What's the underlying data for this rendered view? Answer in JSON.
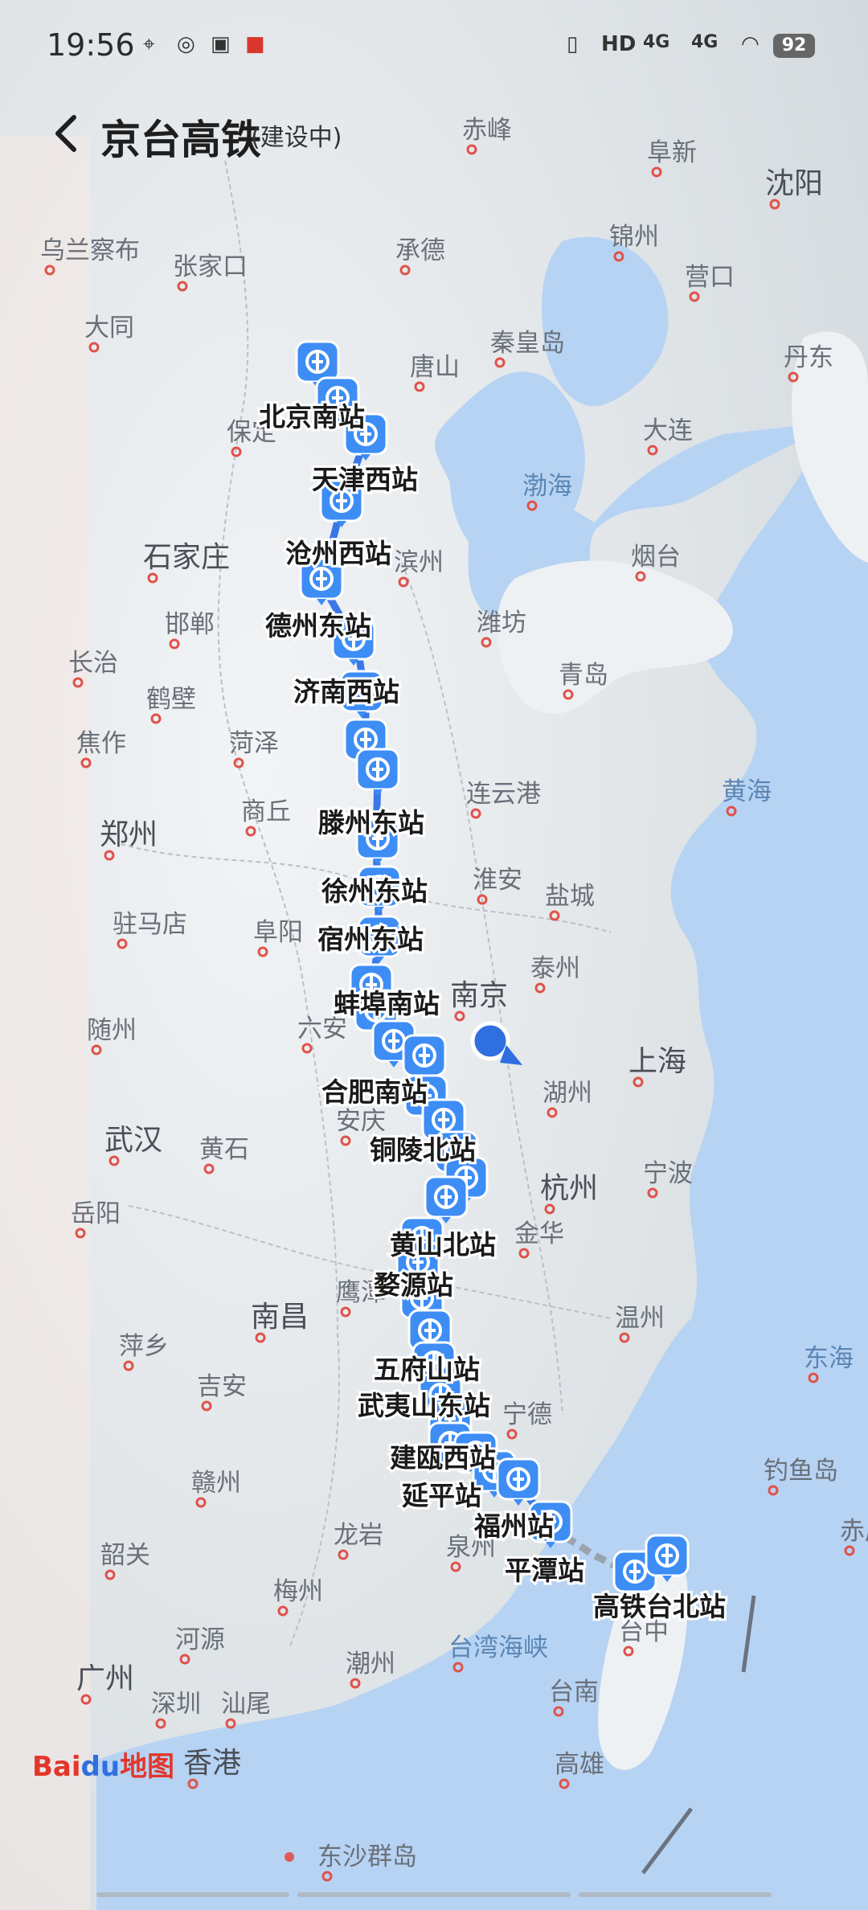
{
  "status": {
    "time": "19:56",
    "battery": "92",
    "net1": "4G",
    "net2": "4G",
    "hd": "HD"
  },
  "header": {
    "back_icon": "chevron-left-icon",
    "title": "京台高铁",
    "subtitle": "(建设中)"
  },
  "map": {
    "cities": [
      {
        "name": "赤峰"
      },
      {
        "name": "阜新"
      },
      {
        "name": "沈阳"
      },
      {
        "name": "乌兰察布"
      },
      {
        "name": "张家口"
      },
      {
        "name": "承德"
      },
      {
        "name": "锦州"
      },
      {
        "name": "营口"
      },
      {
        "name": "大同"
      },
      {
        "name": "秦皇岛"
      },
      {
        "name": "唐山"
      },
      {
        "name": "丹东"
      },
      {
        "name": "保定"
      },
      {
        "name": "大连"
      },
      {
        "name": "渤海"
      },
      {
        "name": "石家庄"
      },
      {
        "name": "滨州"
      },
      {
        "name": "烟台"
      },
      {
        "name": "邯郸"
      },
      {
        "name": "潍坊"
      },
      {
        "name": "长治"
      },
      {
        "name": "鹤壁"
      },
      {
        "name": "青岛"
      },
      {
        "name": "焦作"
      },
      {
        "name": "菏泽"
      },
      {
        "name": "黄海"
      },
      {
        "name": "郑州"
      },
      {
        "name": "商丘"
      },
      {
        "name": "连云港"
      },
      {
        "name": "驻马店"
      },
      {
        "name": "阜阳"
      },
      {
        "name": "淮安"
      },
      {
        "name": "盐城"
      },
      {
        "name": "泰州"
      },
      {
        "name": "随州"
      },
      {
        "name": "六安"
      },
      {
        "name": "南京"
      },
      {
        "name": "上海"
      },
      {
        "name": "湖州"
      },
      {
        "name": "武汉"
      },
      {
        "name": "黄石"
      },
      {
        "name": "安庆"
      },
      {
        "name": "杭州"
      },
      {
        "name": "宁波"
      },
      {
        "name": "岳阳"
      },
      {
        "name": "金华"
      },
      {
        "name": "南昌"
      },
      {
        "name": "鹰潭"
      },
      {
        "name": "温州"
      },
      {
        "name": "萍乡"
      },
      {
        "name": "吉安"
      },
      {
        "name": "东海"
      },
      {
        "name": "宁德"
      },
      {
        "name": "赣州"
      },
      {
        "name": "钓鱼岛"
      },
      {
        "name": "龙岩"
      },
      {
        "name": "泉州"
      },
      {
        "name": "赤尾"
      },
      {
        "name": "韶关"
      },
      {
        "name": "梅州"
      },
      {
        "name": "台中"
      },
      {
        "name": "河源"
      },
      {
        "name": "潮州"
      },
      {
        "name": "台湾海峡"
      },
      {
        "name": "广州"
      },
      {
        "name": "深圳"
      },
      {
        "name": "汕尾"
      },
      {
        "name": "台南"
      },
      {
        "name": "香港"
      },
      {
        "name": "高雄"
      },
      {
        "name": "东沙群岛"
      }
    ],
    "stations": [
      {
        "name": "北京南站"
      },
      {
        "name": "天津西站"
      },
      {
        "name": "沧州西站"
      },
      {
        "name": "德州东站"
      },
      {
        "name": "济南西站"
      },
      {
        "name": "滕州东站"
      },
      {
        "name": "徐州东站"
      },
      {
        "name": "宿州东站"
      },
      {
        "name": "蚌埠南站"
      },
      {
        "name": "合肥南站"
      },
      {
        "name": "铜陵北站"
      },
      {
        "name": "黄山北站"
      },
      {
        "name": "婺源站"
      },
      {
        "name": "五府山站"
      },
      {
        "name": "武夷山东站"
      },
      {
        "name": "建瓯西站"
      },
      {
        "name": "延平站"
      },
      {
        "name": "福州站"
      },
      {
        "name": "平潭站"
      },
      {
        "name": "高铁台北站"
      }
    ],
    "route_color": "#3a78e8",
    "marker_color": "#3d8df5",
    "sea_color": "#b7d3f3",
    "land_color": "#eef1f3",
    "logo_text": "Baidu地图"
  }
}
